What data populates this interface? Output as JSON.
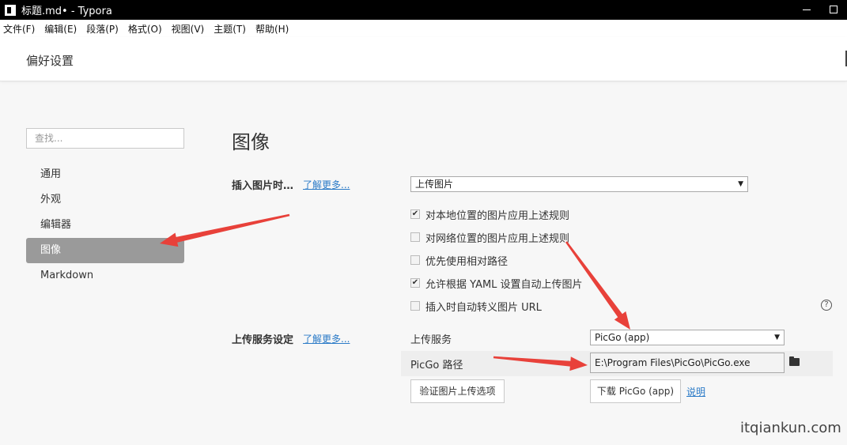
{
  "window": {
    "title": "标题.md• - Typora"
  },
  "menu": [
    "文件(F)",
    "编辑(E)",
    "段落(P)",
    "格式(O)",
    "视图(V)",
    "主题(T)",
    "帮助(H)"
  ],
  "header": {
    "title": "偏好设置"
  },
  "sidebar": {
    "search_placeholder": "查找...",
    "items": [
      {
        "label": "通用",
        "active": false
      },
      {
        "label": "外观",
        "active": false
      },
      {
        "label": "编辑器",
        "active": false
      },
      {
        "label": "图像",
        "active": true
      },
      {
        "label": "Markdown",
        "active": false
      }
    ]
  },
  "main": {
    "title": "图像",
    "insert_image": {
      "label": "插入图片时…",
      "learn_more": "了解更多...",
      "select_value": "上传图片"
    },
    "options": [
      {
        "label": "对本地位置的图片应用上述规则",
        "checked": true
      },
      {
        "label": "对网络位置的图片应用上述规则",
        "checked": false
      },
      {
        "label": "优先使用相对路径",
        "checked": false
      },
      {
        "label": "允许根据 YAML 设置自动上传图片",
        "checked": true
      },
      {
        "label": "插入时自动转义图片 URL",
        "checked": false
      }
    ],
    "upload": {
      "label": "上传服务设定",
      "learn_more": "了解更多...",
      "service_label": "上传服务",
      "service_value": "PicGo (app)",
      "path_label": "PicGo 路径",
      "path_value": "E:\\Program Files\\PicGo\\PicGo.exe",
      "verify_button": "验证图片上传选项",
      "download_button": "下载 PicGo (app)",
      "explain_link": "说明"
    }
  },
  "icons": {
    "check": "✔",
    "help": "?",
    "dropdown": "▼"
  },
  "watermark": "itqiankun.com",
  "annotation_color": "#e8413a"
}
